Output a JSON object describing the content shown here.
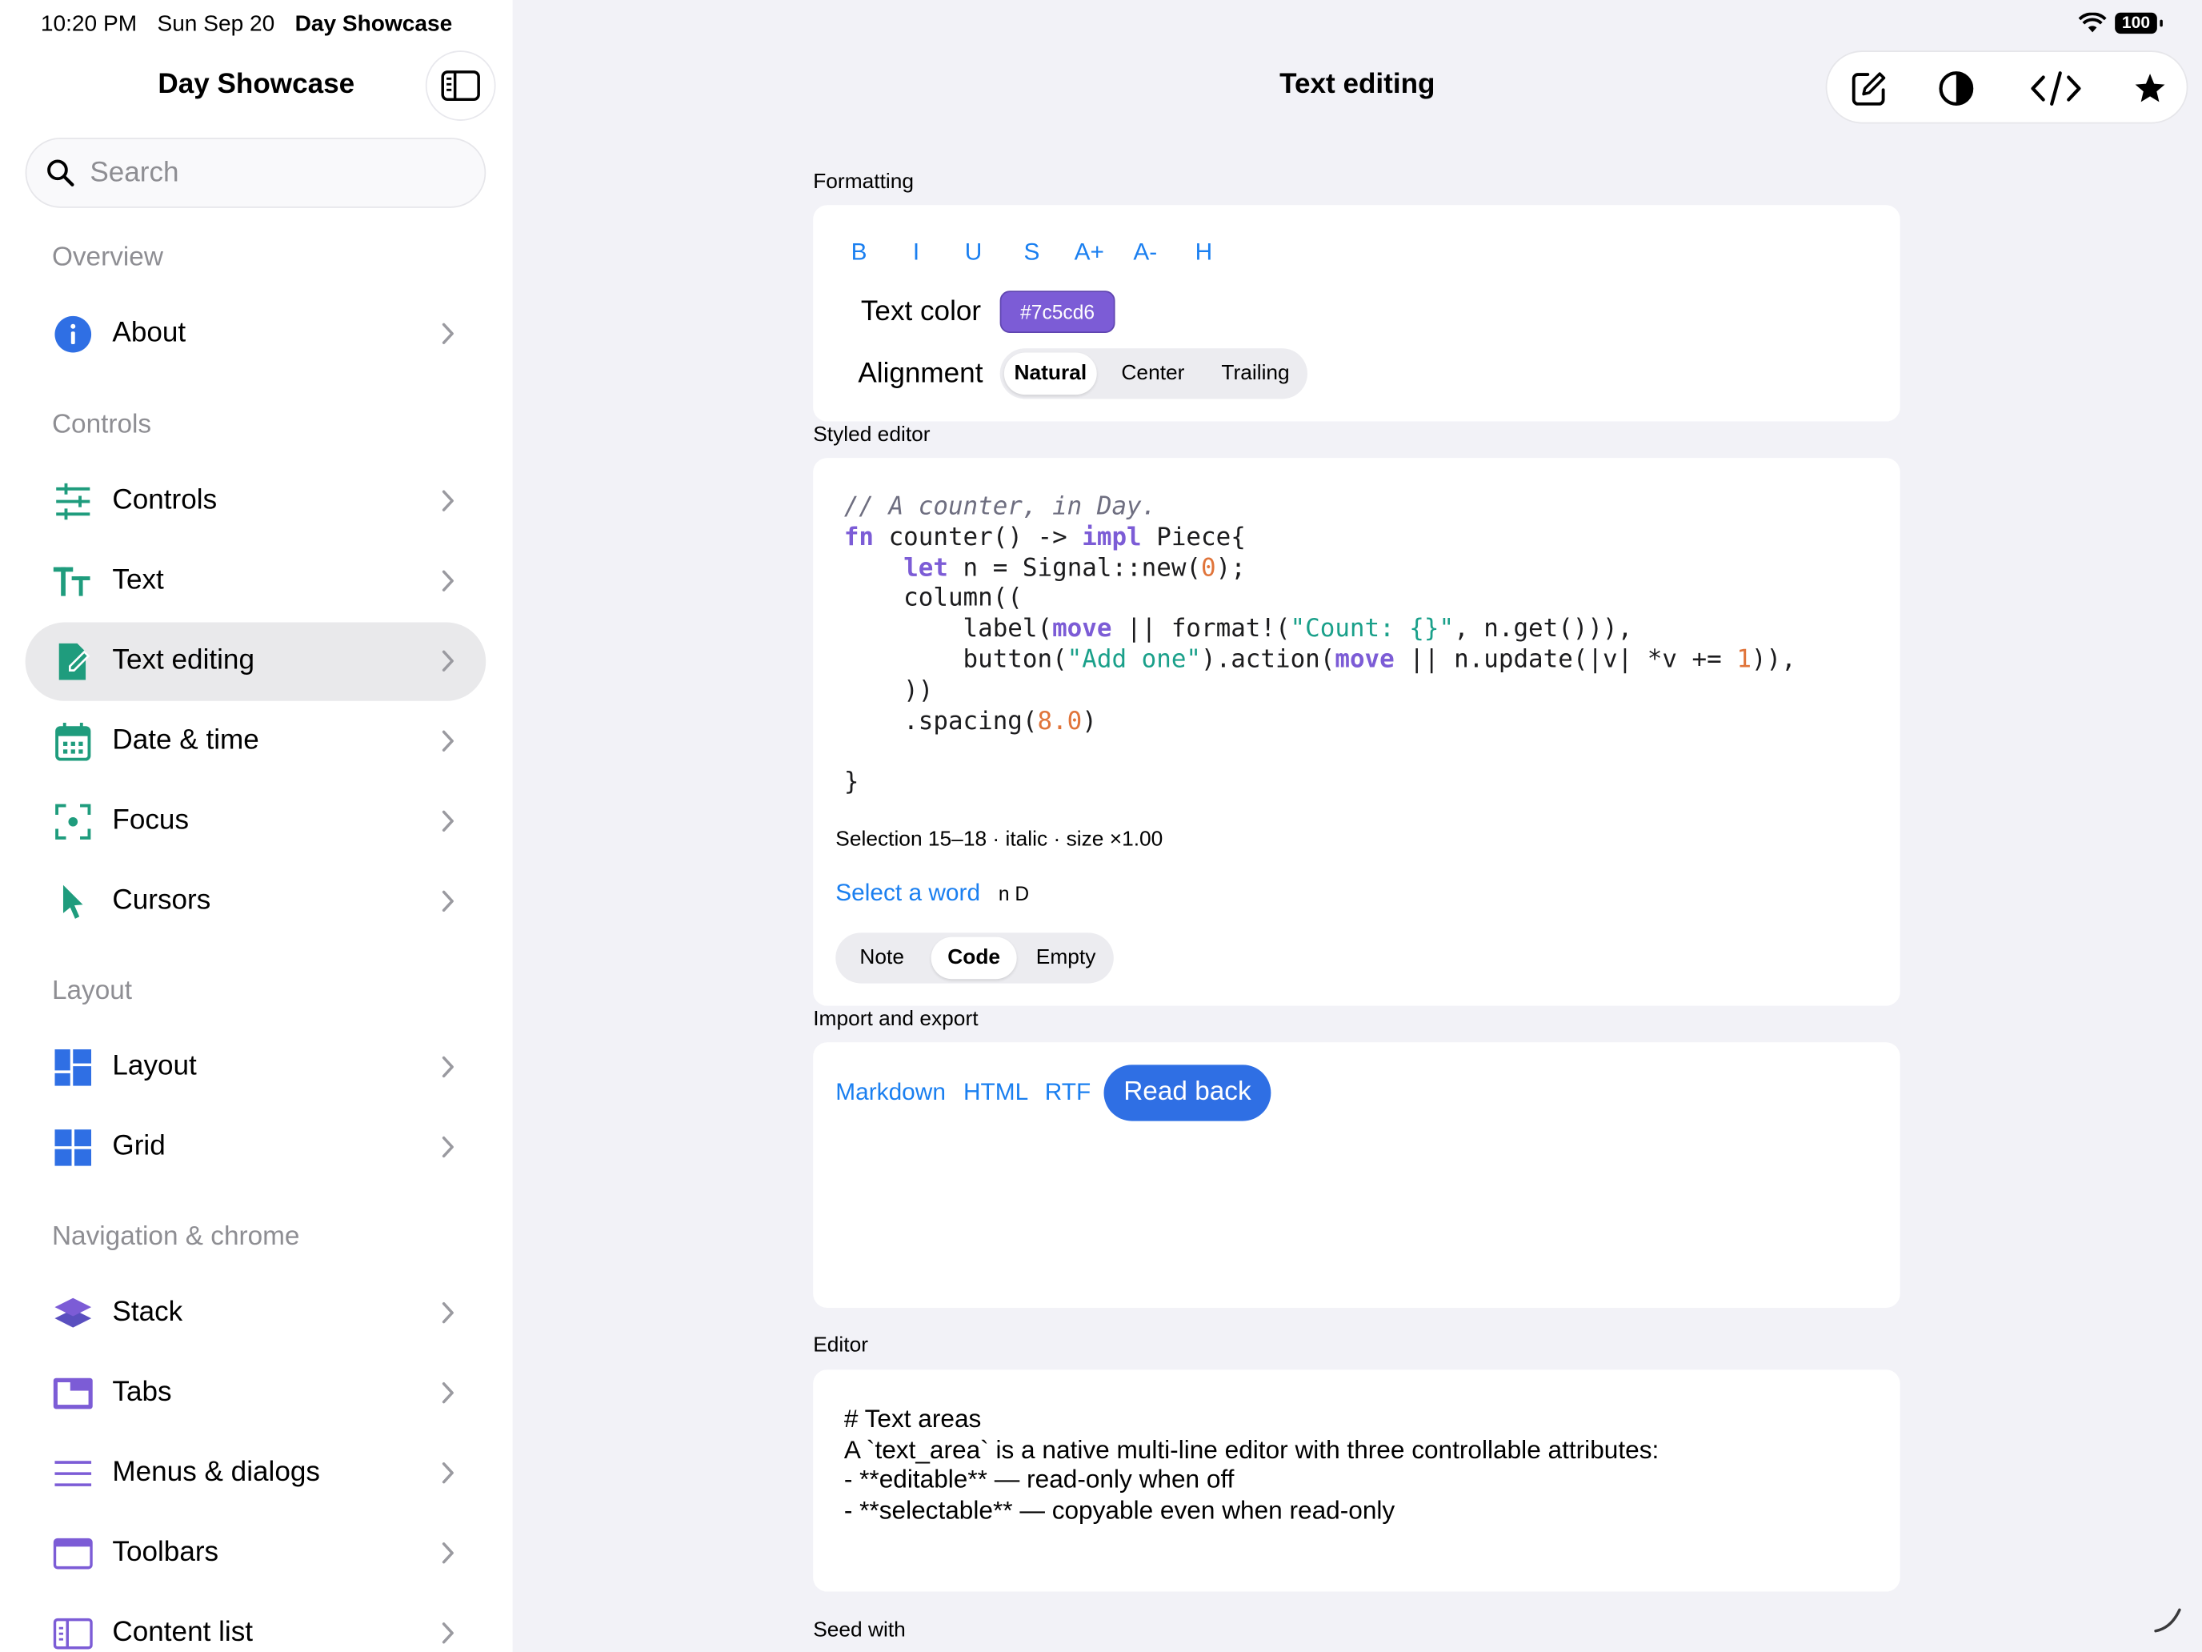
{
  "status_bar": {
    "time": "10:20 PM",
    "date": "Sun Sep 20",
    "app": "Day Showcase",
    "battery": "100"
  },
  "sidebar": {
    "title": "Day Showcase",
    "search_placeholder": "Search",
    "sections": [
      {
        "header": "Overview",
        "items": [
          {
            "label": "About",
            "icon": "info-icon"
          }
        ]
      },
      {
        "header": "Controls",
        "items": [
          {
            "label": "Controls",
            "icon": "sliders-icon"
          },
          {
            "label": "Text",
            "icon": "text-size-icon"
          },
          {
            "label": "Text editing",
            "icon": "edit-document-icon",
            "selected": true
          },
          {
            "label": "Date & time",
            "icon": "calendar-icon"
          },
          {
            "label": "Focus",
            "icon": "focus-icon"
          },
          {
            "label": "Cursors",
            "icon": "pointer-icon"
          }
        ]
      },
      {
        "header": "Layout",
        "items": [
          {
            "label": "Layout",
            "icon": "layout-icon"
          },
          {
            "label": "Grid",
            "icon": "grid-icon"
          }
        ]
      },
      {
        "header": "Navigation & chrome",
        "items": [
          {
            "label": "Stack",
            "icon": "stack-icon"
          },
          {
            "label": "Tabs",
            "icon": "tabs-icon"
          },
          {
            "label": "Menus & dialogs",
            "icon": "menu-icon"
          },
          {
            "label": "Toolbars",
            "icon": "toolbar-icon"
          },
          {
            "label": "Content list",
            "icon": "content-list-icon"
          }
        ]
      }
    ]
  },
  "main": {
    "title": "Text editing",
    "toolbar_icons": [
      "compose-icon",
      "contrast-icon",
      "code-icon",
      "star-icon"
    ],
    "formatting": {
      "label": "Formatting",
      "buttons": [
        "B",
        "I",
        "U",
        "S",
        "A+",
        "A-",
        "H"
      ],
      "text_color_label": "Text color",
      "text_color_value": "#7c5cd6",
      "alignment_label": "Alignment",
      "alignment_options": [
        "Natural",
        "Center",
        "Trailing"
      ],
      "alignment_selected": "Natural"
    },
    "styled_editor": {
      "label": "Styled editor",
      "code_lines": [
        "// A counter, in Day.",
        "fn counter() -> impl Piece{",
        "    let n = Signal::new(0);",
        "    column((",
        "        label(move || format!(\"Count: {}\", n.get())),",
        "        button(\"Add one\").action(move || n.update(|v| *v += 1)),",
        "    ))",
        "    .spacing(8.0)",
        "",
        "}"
      ],
      "selection_info": "Selection 15–18 · italic · size ×1.00",
      "select_word_link": "Select a word",
      "selected_text": "n D",
      "seed_options": [
        "Note",
        "Code",
        "Empty"
      ],
      "seed_selected": "Code"
    },
    "import_export": {
      "label": "Import and export",
      "links": [
        "Markdown",
        "HTML",
        "RTF"
      ],
      "read_back": "Read back"
    },
    "editor": {
      "label": "Editor",
      "lines": [
        "# Text areas",
        "",
        "A `text_area` is a native multi-line editor with three controllable attributes:",
        "",
        "- **editable** — read-only when off",
        "- **selectable** — copyable even when read-only"
      ]
    },
    "seed_with_label": "Seed with"
  }
}
